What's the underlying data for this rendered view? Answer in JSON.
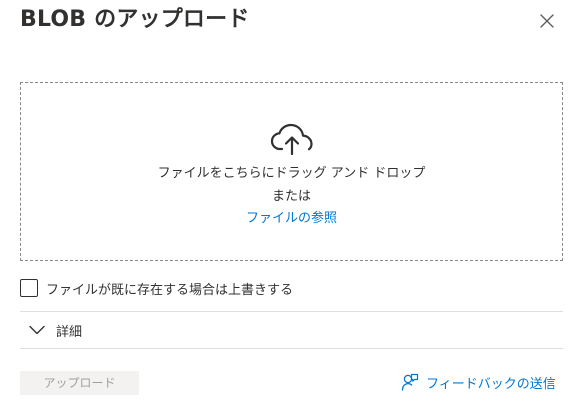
{
  "panel": {
    "title": "BLOB のアップロード",
    "close_icon": "close-icon"
  },
  "dropzone": {
    "icon": "cloud-upload-icon",
    "line1": "ファイルをこちらにドラッグ アンド ドロップ",
    "line2": "または",
    "browse_link": "ファイルの参照"
  },
  "overwrite": {
    "checked": false,
    "label": "ファイルが既に存在する場合は上書きする"
  },
  "details": {
    "icon": "chevron-down-icon",
    "label": "詳細"
  },
  "footer": {
    "upload_label": "アップロード",
    "upload_disabled": true,
    "feedback_icon": "feedback-person-icon",
    "feedback_label": "フィードバックの送信"
  },
  "colors": {
    "link": "#0078d4",
    "text": "#323130",
    "disabled_bg": "#f3f2f1",
    "disabled_text": "#a19f9d"
  }
}
